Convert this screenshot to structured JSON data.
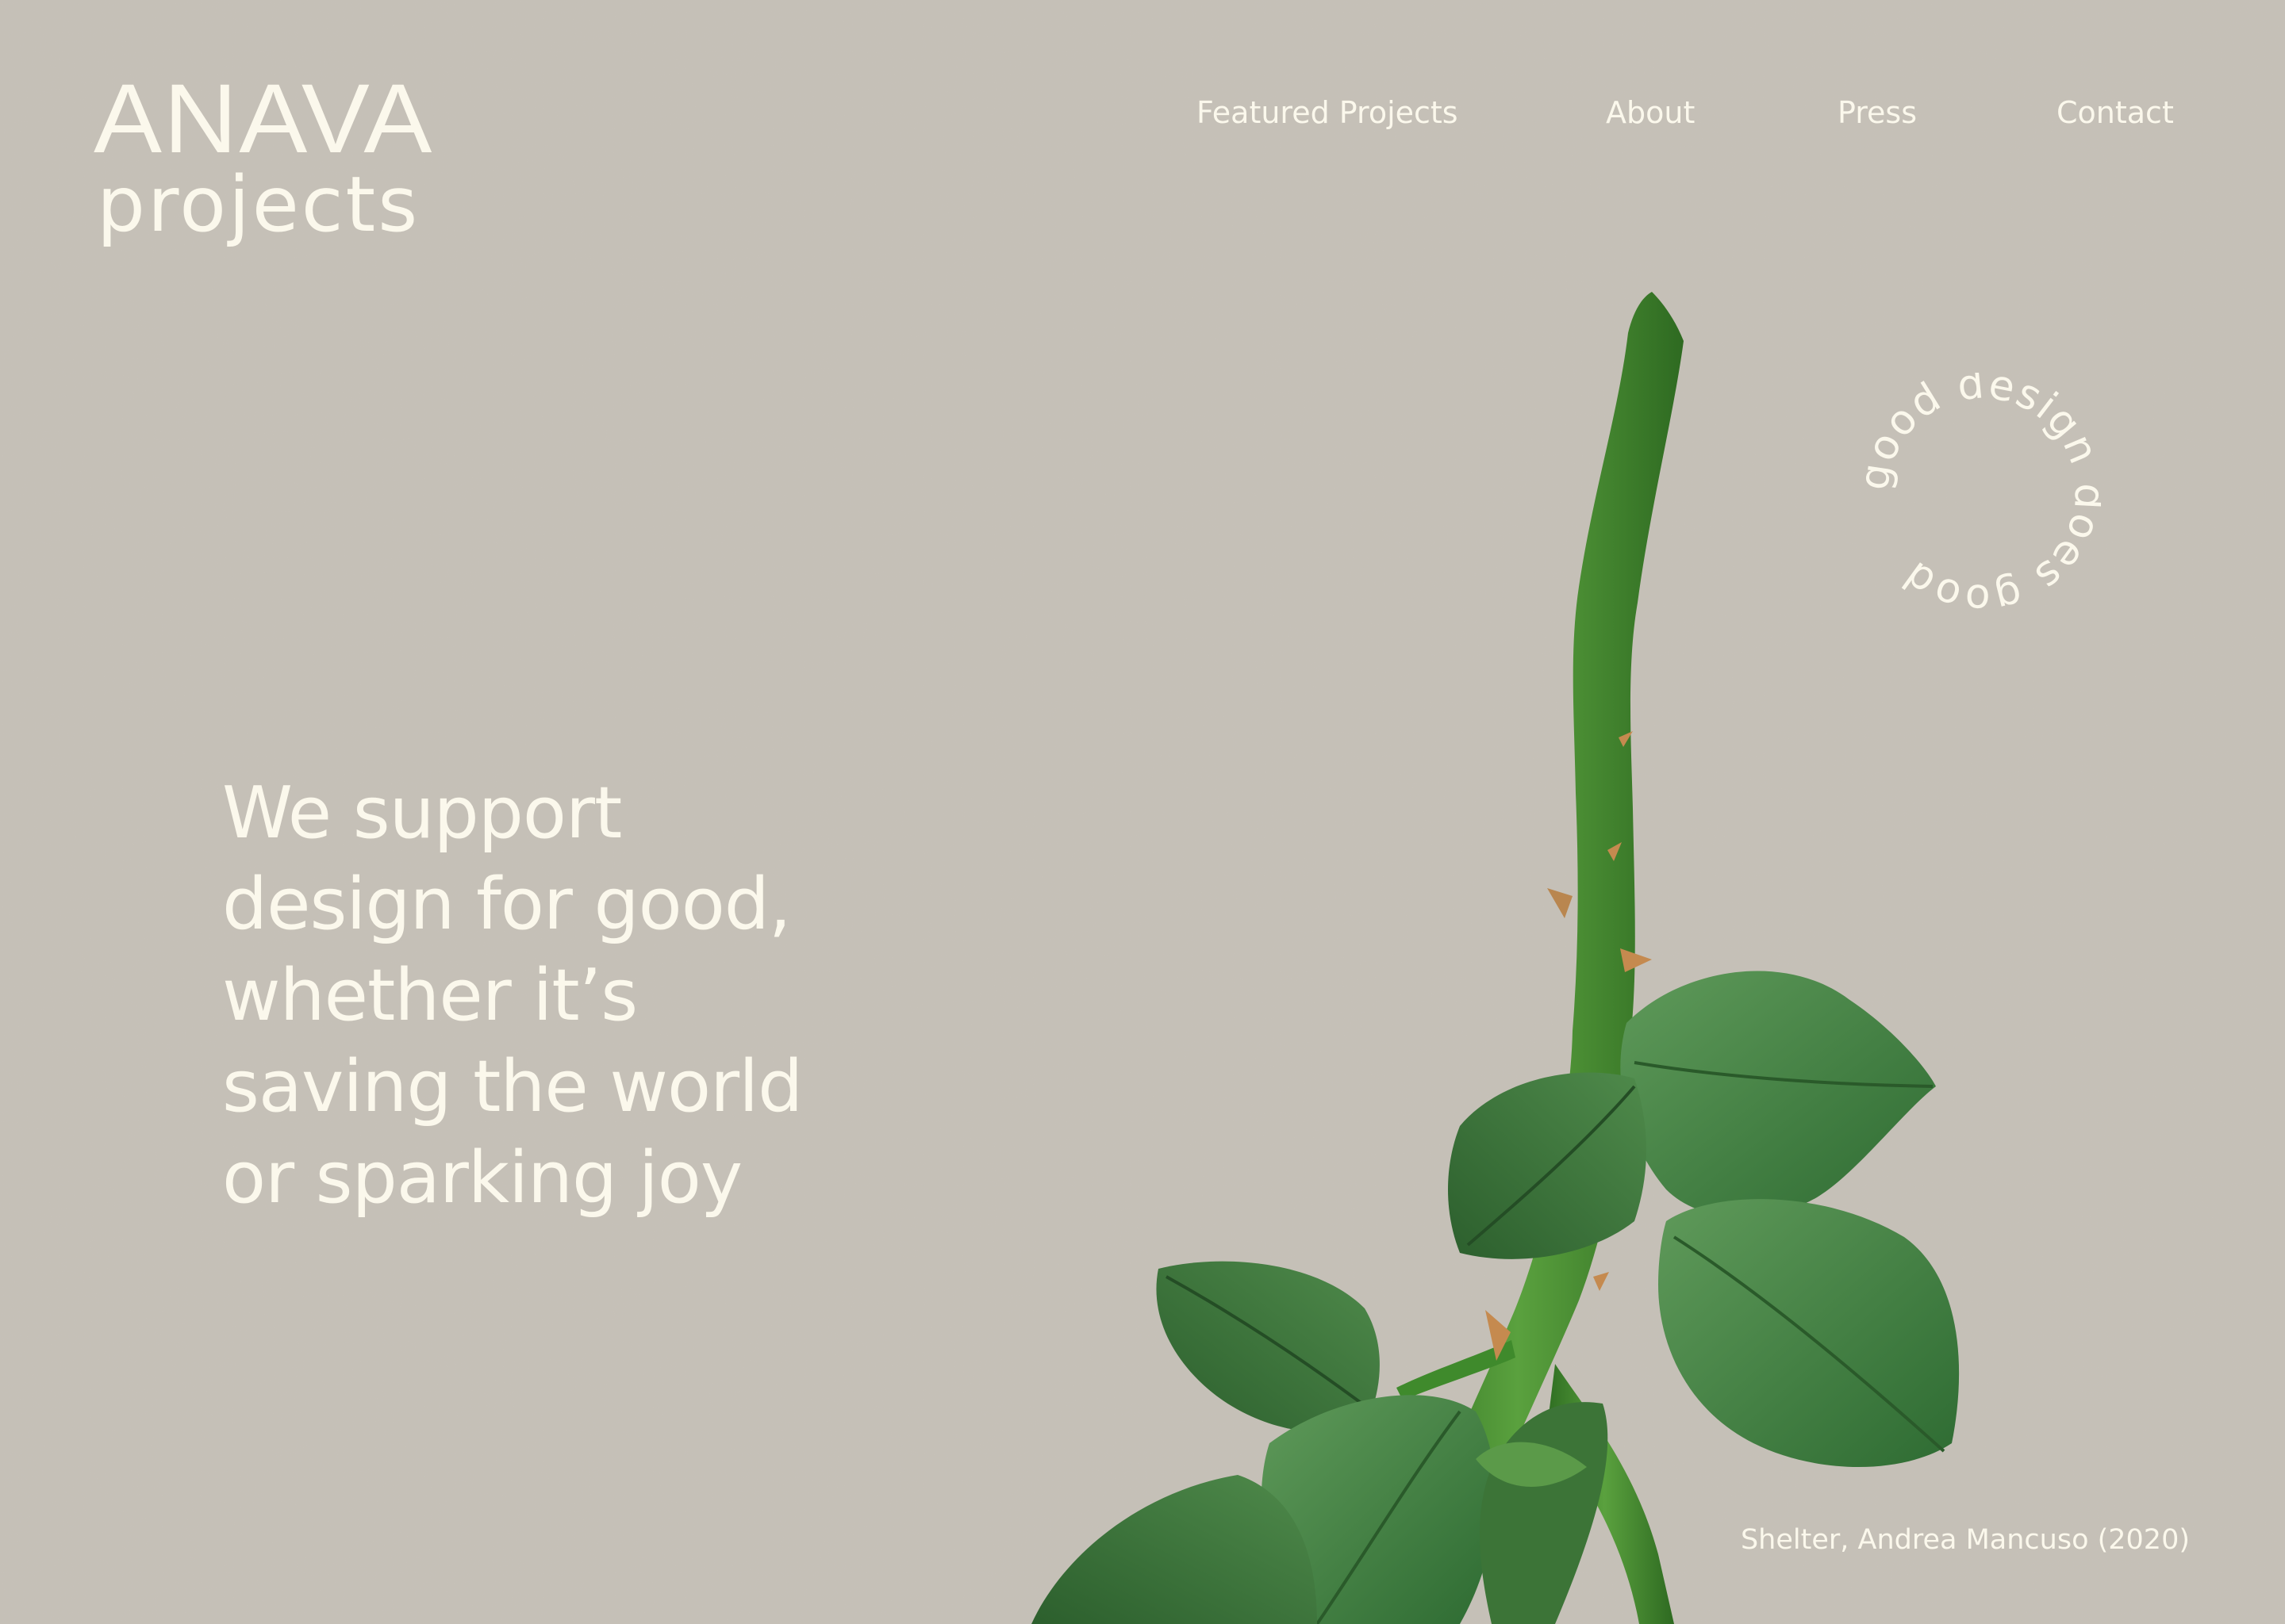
{
  "brand": {
    "logo_main": "ANAVA",
    "logo_sub": "projects"
  },
  "nav": {
    "items": [
      {
        "label": "Featured Projects"
      },
      {
        "label": "About"
      },
      {
        "label": "Press"
      },
      {
        "label": "Contact"
      }
    ]
  },
  "hero": {
    "headline_lines": [
      "We support",
      "design for good,",
      "whether it’s",
      "saving the world",
      "or sparking joy"
    ]
  },
  "badge": {
    "circular_text": "good design does good"
  },
  "artwork": {
    "caption": "Shelter, Andrea Mancuso (2020)"
  },
  "colors": {
    "background": "#c6c1b8",
    "text": "#fbf8ec",
    "stem": "#4a8f33",
    "leaf": "#3f7a3c",
    "thorn": "#c58a4f"
  }
}
